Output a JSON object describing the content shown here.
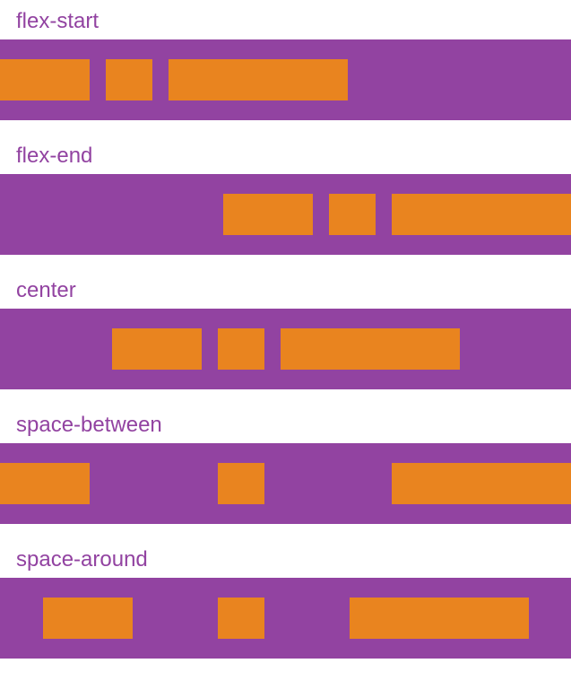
{
  "examples": [
    {
      "label": "flex-start",
      "justify": "flex-start"
    },
    {
      "label": "flex-end",
      "justify": "flex-end"
    },
    {
      "label": "center",
      "justify": "center"
    },
    {
      "label": "space-between",
      "justify": "space-between"
    },
    {
      "label": "space-around",
      "justify": "space-around"
    }
  ],
  "items_per_row": 3
}
